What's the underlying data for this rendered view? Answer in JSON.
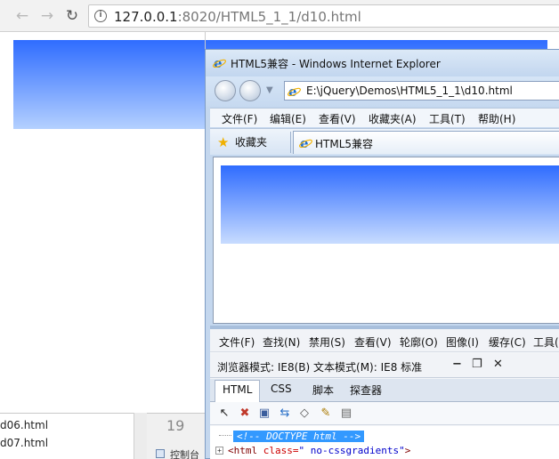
{
  "chrome": {
    "back_glyph": "←",
    "forward_glyph": "→",
    "reload_glyph": "↻",
    "url_host": "127.0.0.1",
    "url_rest": ":8020/HTML5_1_1/d10.html"
  },
  "filelist": {
    "files": [
      "d06.html",
      "d07.html"
    ],
    "line_number": "19",
    "console_label": "控制台"
  },
  "ie": {
    "title": "HTML5兼容 - Windows Internet Explorer",
    "address": "E:\\jQuery\\Demos\\HTML5_1_1\\d10.html",
    "menu": [
      "文件(F)",
      "编辑(E)",
      "查看(V)",
      "收藏夹(A)",
      "工具(T)",
      "帮助(H)"
    ],
    "favorites_label": "收藏夹",
    "tab_title": "HTML5兼容"
  },
  "devtools": {
    "menu": [
      "文件(F)",
      "查找(N)",
      "禁用(S)",
      "查看(V)",
      "轮廓(O)",
      "图像(I)",
      "缓存(C)",
      "工具("
    ],
    "mode_text": "浏览器模式: IE8(B)   文本模式(M): IE8 标准",
    "tabs": [
      "HTML",
      "CSS",
      "脚本",
      "探查器"
    ],
    "tree": {
      "line1": "<!-- DOCTYPE html -->",
      "tag_open": "<html ",
      "attr_name": "class=",
      "attr_value": "\" no-cssgradients\"",
      "tag_close": ">"
    }
  },
  "colors": {
    "gradient_top": "#2f6cff",
    "gradient_bottom": "#b4d0ff",
    "ie_frame": "#c4d7ee",
    "selection": "#3399ff"
  }
}
